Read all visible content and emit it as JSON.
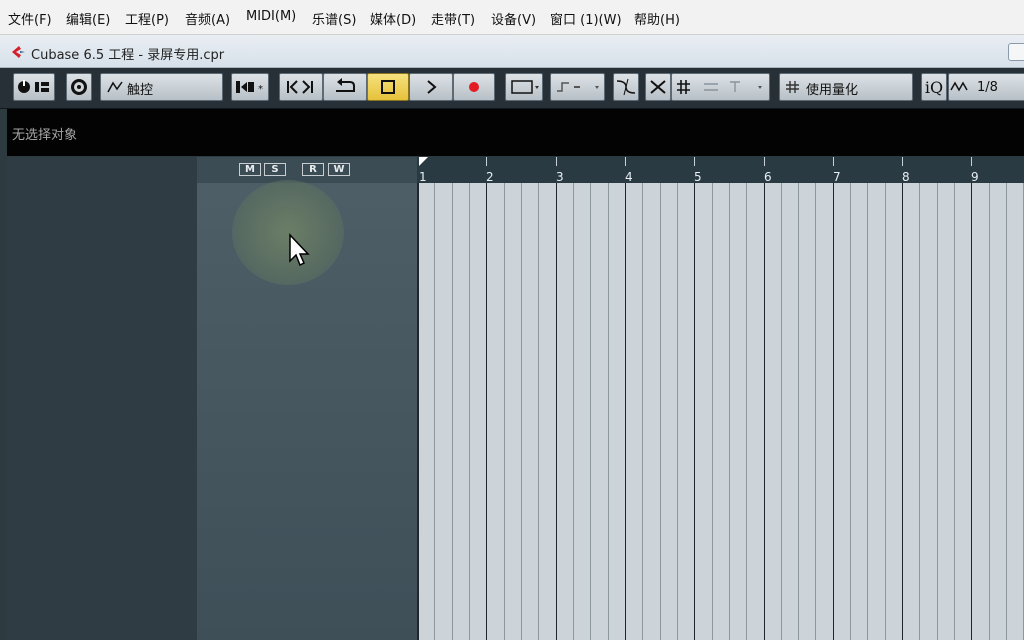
{
  "menu": [
    "文件(F)",
    "编辑(E)",
    "工程(P)",
    "音频(A)",
    "MIDI(M)",
    "乐谱(S)",
    "媒体(D)",
    "走带(T)",
    "设备(V)",
    "窗口 (1)(W)",
    "帮助(H)"
  ],
  "window": {
    "title": "Cubase 6.5 工程 - 录屏专用.cpr"
  },
  "toolbar": {
    "automation_mode": "触控",
    "quantize_preset": "使用量化",
    "iq_label": "iQ",
    "snap_value": "1/8"
  },
  "infoline": {
    "text": "无选择对象"
  },
  "tracklist_header_buttons": [
    "M",
    "S",
    "R",
    "W"
  ],
  "ruler": {
    "bars": [
      "1",
      "2",
      "3",
      "4",
      "5",
      "6",
      "7",
      "8",
      "9"
    ]
  },
  "colors": {
    "accent_record": "#e31b23",
    "stop_active": "#f0d35a",
    "grid_bg": "#cdd4d9"
  }
}
